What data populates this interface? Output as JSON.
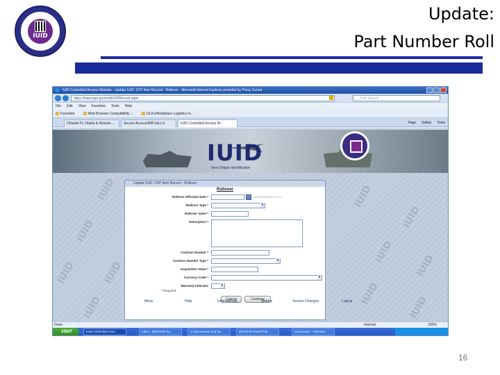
{
  "slide": {
    "title_line1": "Update:",
    "title_line2": "Part Number Roll",
    "page_number": "16",
    "logo_text": "IUID"
  },
  "browser": {
    "window_title": "IUID Controlled Access Website - Update IUID: CFP Item Record - Rollover - Microsoft Internet Explorer provided by Proxy Cursor",
    "address": "https://www.bpn.gov/iuid/IUIDRecord.aspx",
    "search_placeholder": "Live Search",
    "menu": [
      "File",
      "Edit",
      "View",
      "Favorites",
      "Tools",
      "Help"
    ],
    "favorites": [
      "Favorites",
      "Web Browser Compatibility ...",
      "DLA eWorkplace Logistics In..."
    ],
    "tabs": [
      "Orlando FL Hotels & Resorts ...",
      "Secure Access/IRB Ind.t.st",
      "IUID Controlled Access W..."
    ],
    "toolbar_right": [
      "Page",
      "Safety",
      "Tools"
    ],
    "status_left": "Done",
    "status_zone": "Internet",
    "zoom": "100%"
  },
  "banner": {
    "title": "IUID",
    "subtitle": "Item Unique Identification"
  },
  "form": {
    "header": "Update IUID: CFP Item Record - Rollover",
    "title": "Rollover",
    "fields": [
      {
        "label": "Rollover Effective Date *"
      },
      {
        "label": "Rollover Type *"
      },
      {
        "label": "Rollover Value *"
      },
      {
        "label": "Description *"
      },
      {
        "label": "Contract Number *"
      },
      {
        "label": "Contract Number Type *"
      },
      {
        "label": "Acquisition Value *"
      },
      {
        "label": "Currency Code *"
      },
      {
        "label": "Warranty Indicator"
      }
    ],
    "date_format_hint": "(format: MM/DD/YYYY)",
    "required_note": "* Required",
    "cancel_label": "Cancel",
    "continue_label": "Continue"
  },
  "footer_links": [
    "Menu",
    "Help",
    "User Manual",
    "Metrics",
    "Version Changes",
    "Logout"
  ],
  "watermark_text": "IUID",
  "taskbar": {
    "start_label": "start",
    "items": [
      "IUID Controlled Acce",
      "Inbox - Microsoft Ou...",
      "C:\\Documents and Se...",
      "Microsoft PowerPoin...",
      "Document1 - Microsof..."
    ],
    "tray_time": ""
  }
}
